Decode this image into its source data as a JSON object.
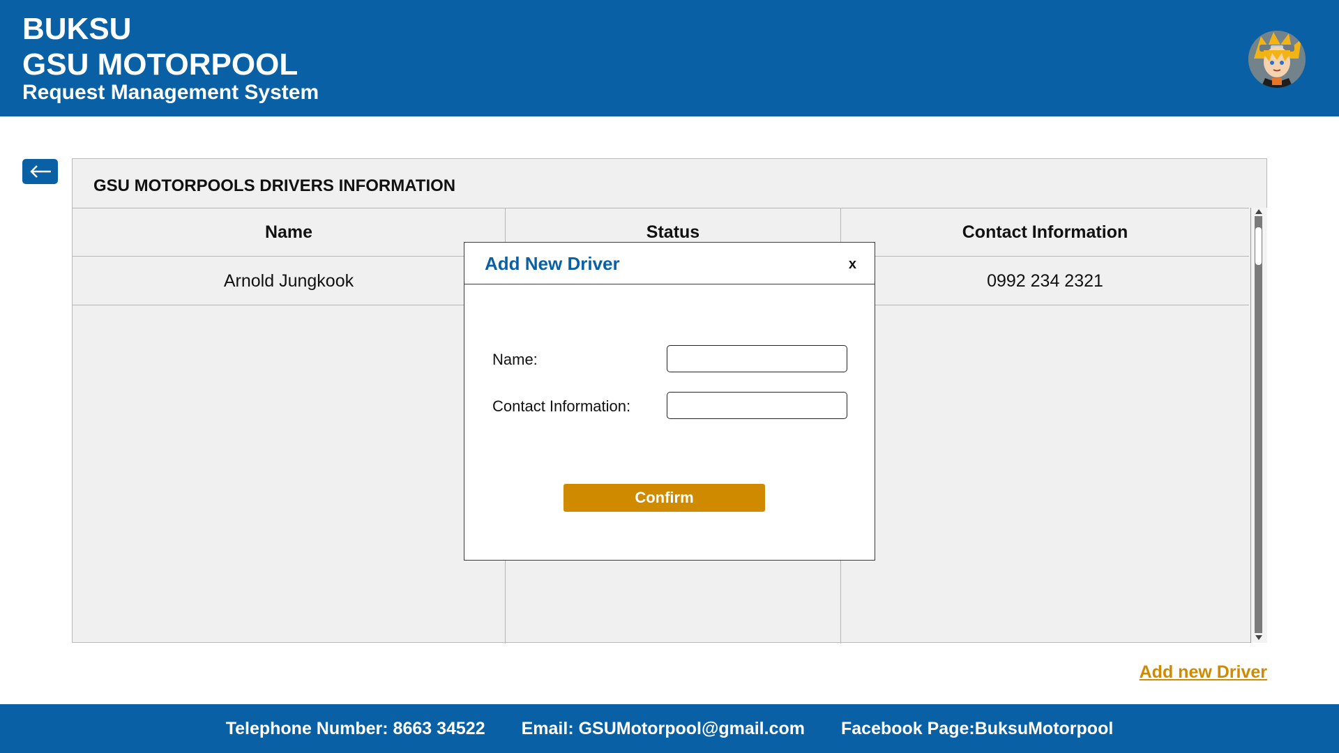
{
  "header": {
    "line1": "BUKSU",
    "line2": "GSU MOTORPOOL",
    "line3": "Request Management System"
  },
  "panel": {
    "title": "GSU MOTORPOOLS DRIVERS INFORMATION",
    "columns": [
      "Name",
      "Status",
      "Contact Information"
    ],
    "rows": [
      {
        "name": "Arnold Jungkook",
        "status": "",
        "contact": "0992 234 2321"
      }
    ]
  },
  "add_driver_link": "Add new Driver",
  "modal": {
    "title": "Add New Driver",
    "close": "x",
    "name_label": "Name:",
    "name_value": "",
    "contact_label": "Contact Information:",
    "contact_value": "",
    "confirm_label": "Confirm"
  },
  "footer": {
    "telephone": "Telephone Number: 8663 34522",
    "email": "Email: GSUMotorpool@gmail.com",
    "facebook": "Facebook Page:BuksuMotorpool"
  },
  "colors": {
    "primary": "#0a60a5",
    "accent": "#d08a00",
    "panel_bg": "#f0f0f0"
  },
  "icons": {
    "back": "arrow-left-icon",
    "avatar": "user-avatar"
  }
}
